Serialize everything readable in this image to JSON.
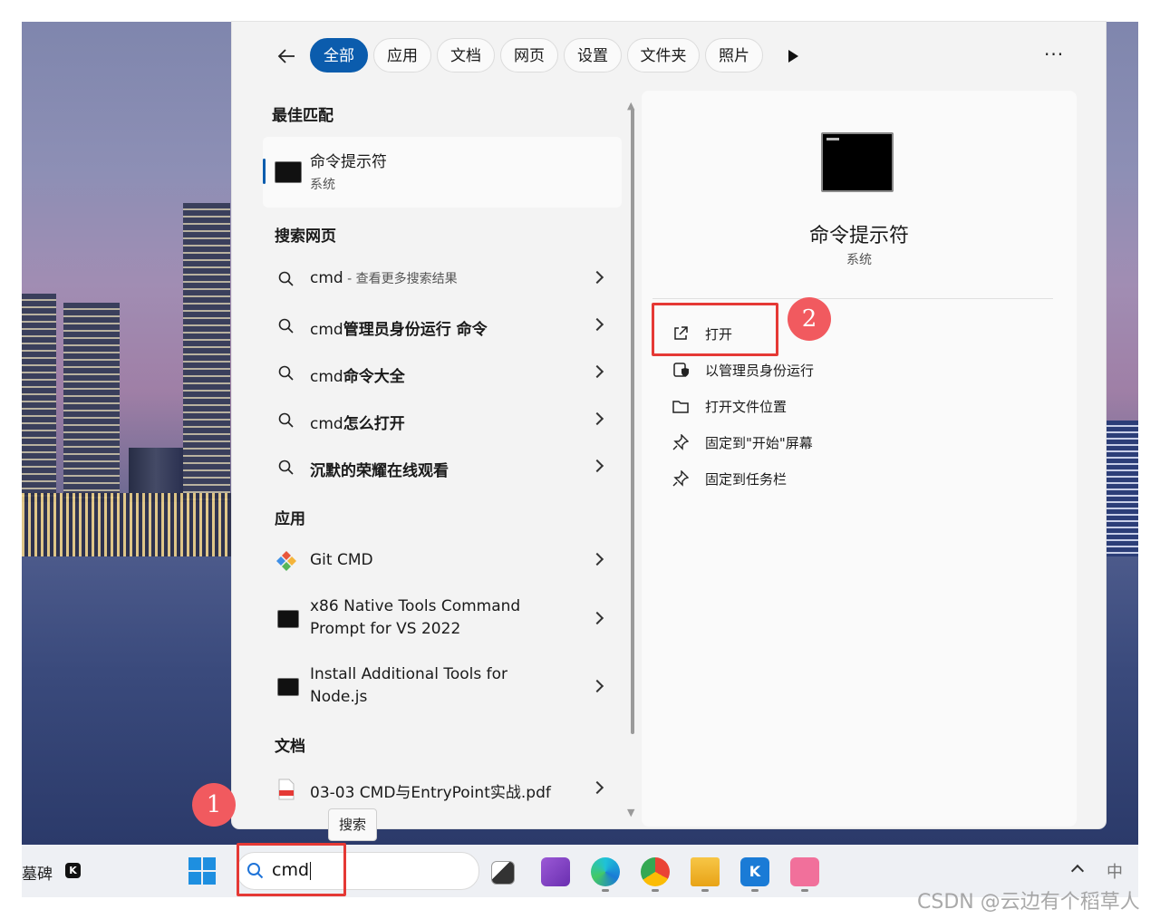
{
  "filters": {
    "tabs": [
      {
        "label": "全部",
        "active": true
      },
      {
        "label": "应用"
      },
      {
        "label": "文档"
      },
      {
        "label": "网页"
      },
      {
        "label": "设置"
      },
      {
        "label": "文件夹"
      },
      {
        "label": "照片"
      }
    ],
    "more_label": "···"
  },
  "best_match": {
    "heading": "最佳匹配",
    "title": "命令提示符",
    "subtitle": "系统"
  },
  "web": {
    "heading": "搜索网页",
    "items": [
      {
        "prefix": "cmd",
        "suffix": " - 查看更多搜索结果"
      },
      {
        "prefix": "cmd",
        "bold": "管理员身份运行 命令"
      },
      {
        "prefix": "cmd",
        "bold": "命令大全"
      },
      {
        "prefix": "cmd",
        "bold": "怎么打开"
      },
      {
        "prefix": "",
        "bold": "沉默的荣耀在线观看"
      }
    ]
  },
  "apps": {
    "heading": "应用",
    "items": [
      {
        "line1": "Git CMD",
        "icon": "git-icon"
      },
      {
        "line1": "x86 Native Tools Command",
        "line2": "Prompt for VS 2022",
        "icon": "terminal-icon"
      },
      {
        "line1": "Install Additional Tools for",
        "line2": "Node.js",
        "icon": "terminal-icon"
      }
    ]
  },
  "docs": {
    "heading": "文档",
    "items": [
      {
        "label": "03-03 CMD与EntryPoint实战.pdf",
        "icon": "pdf-icon"
      }
    ]
  },
  "detail": {
    "title": "命令提示符",
    "subtitle": "系统",
    "actions": [
      {
        "label": "打开",
        "icon": "open-external-icon"
      },
      {
        "label": "以管理员身份运行",
        "icon": "admin-shield-icon"
      },
      {
        "label": "打开文件位置",
        "icon": "folder-icon"
      },
      {
        "label": "固定到\"开始\"屏幕",
        "icon": "pin-icon"
      },
      {
        "label": "固定到任务栏",
        "icon": "pin-icon"
      }
    ]
  },
  "annotations": {
    "badge1": "1",
    "badge2": "2",
    "accent": "#e53935"
  },
  "taskbar": {
    "left_text": "墓碑",
    "search_value": "cmd",
    "tooltip": "搜索",
    "ime": "中"
  },
  "watermark": "CSDN @云边有个稻草人",
  "colors": {
    "accent": "#0b5cad",
    "annotation_red": "#e53935",
    "panel_bg": "#f3f3f3"
  }
}
